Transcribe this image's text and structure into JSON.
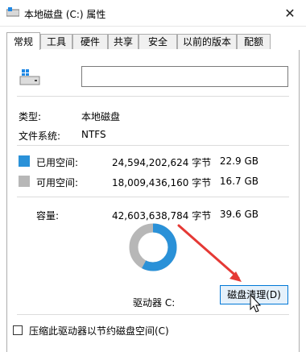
{
  "window": {
    "title": "本地磁盘 (C:) 属性",
    "close_glyph": "✕"
  },
  "tabs": [
    "常规",
    "工具",
    "硬件",
    "共享",
    "安全",
    "以前的版本",
    "配额"
  ],
  "general": {
    "name_value": "",
    "type_label": "类型:",
    "type_value": "本地磁盘",
    "fs_label": "文件系统:",
    "fs_value": "NTFS",
    "used_label": "已用空间:",
    "used_bytes": "24,594,202,624 字节",
    "used_size": "22.9 GB",
    "free_label": "可用空间:",
    "free_bytes": "18,009,436,160 字节",
    "free_size": "16.7 GB",
    "capacity_label": "容量:",
    "capacity_bytes": "42,603,638,784 字节",
    "capacity_size": "39.6 GB",
    "drive_label": "驱动器 C:",
    "cleanup_button": "磁盘清理(D)",
    "compress_checkbox": "压缩此驱动器以节约磁盘空间(C)"
  },
  "colors": {
    "used": "#2a91d8",
    "free": "#b7b7b7",
    "arrow": "#e53935",
    "accent": "#0078d7"
  }
}
